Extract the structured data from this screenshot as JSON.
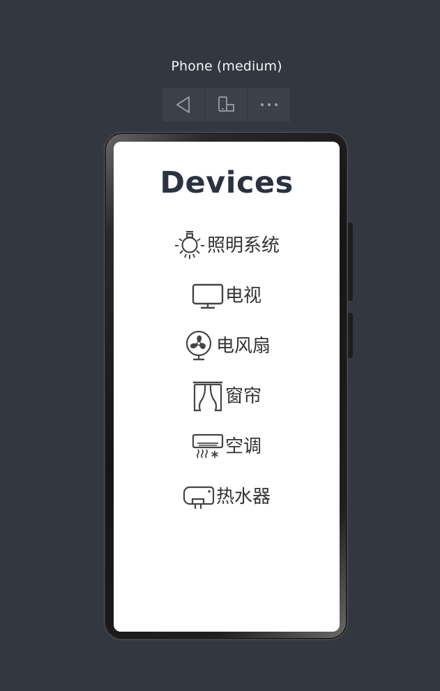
{
  "preview": {
    "device_title": "Phone (medium)",
    "toolbar": [
      {
        "name": "back-icon"
      },
      {
        "name": "rotate-device-icon"
      },
      {
        "name": "more-icon"
      }
    ]
  },
  "app": {
    "title": "Devices",
    "items": [
      {
        "label": "照明系统",
        "icon": "lightbulb-icon"
      },
      {
        "label": "电视",
        "icon": "tv-icon"
      },
      {
        "label": "电风扇",
        "icon": "fan-icon"
      },
      {
        "label": "窗帘",
        "icon": "curtain-icon"
      },
      {
        "label": "空调",
        "icon": "air-conditioner-icon"
      },
      {
        "label": "热水器",
        "icon": "water-heater-icon"
      }
    ]
  },
  "colors": {
    "background": "#333740",
    "toolbar": "#3c4049",
    "title_text": "#2b3341",
    "item_text": "#333333"
  }
}
